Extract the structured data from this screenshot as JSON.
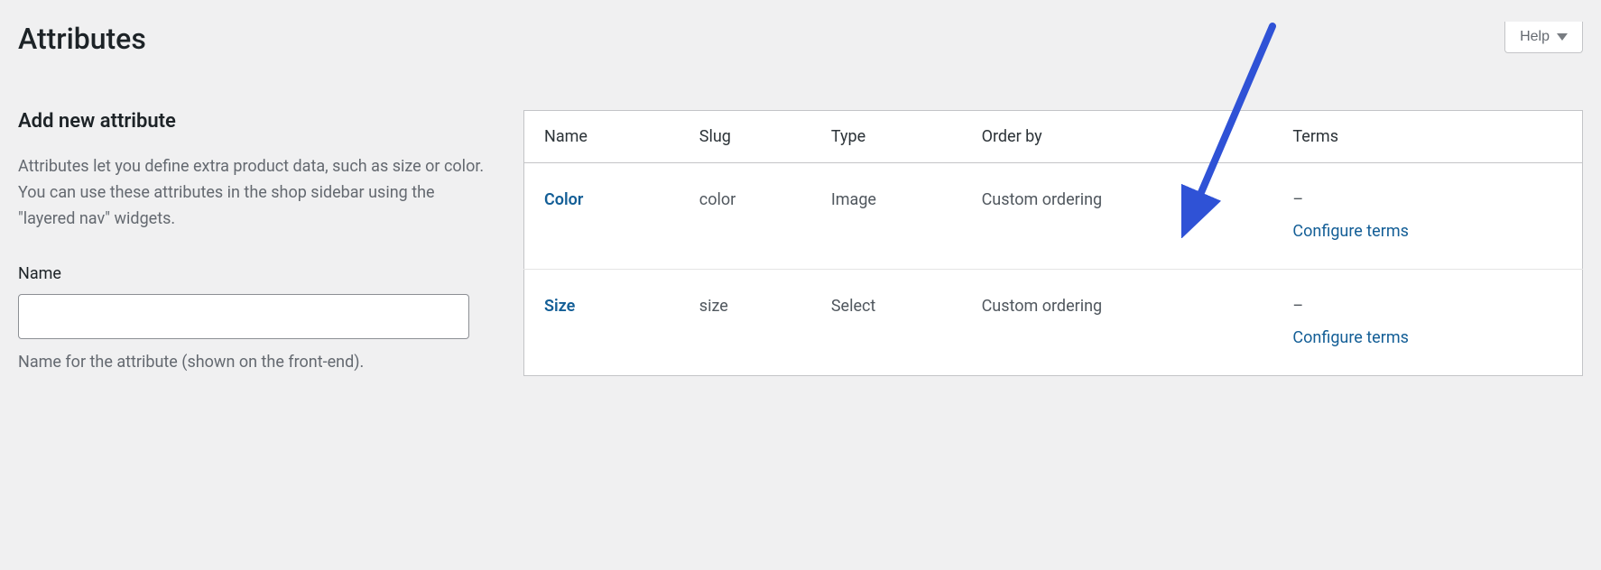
{
  "help": {
    "label": "Help"
  },
  "page": {
    "title": "Attributes"
  },
  "form": {
    "heading": "Add new attribute",
    "description": "Attributes let you define extra product data, such as size or color. You can use these attributes in the shop sidebar using the \"layered nav\" widgets.",
    "name_label": "Name",
    "name_value": "",
    "name_hint": "Name for the attribute (shown on the front-end)."
  },
  "table": {
    "headers": {
      "name": "Name",
      "slug": "Slug",
      "type": "Type",
      "order_by": "Order by",
      "terms": "Terms"
    },
    "rows": [
      {
        "name": "Color",
        "slug": "color",
        "type": "Image",
        "order_by": "Custom ordering",
        "terms_value": "–",
        "configure_label": "Configure terms"
      },
      {
        "name": "Size",
        "slug": "size",
        "type": "Select",
        "order_by": "Custom ordering",
        "terms_value": "–",
        "configure_label": "Configure terms"
      }
    ]
  }
}
